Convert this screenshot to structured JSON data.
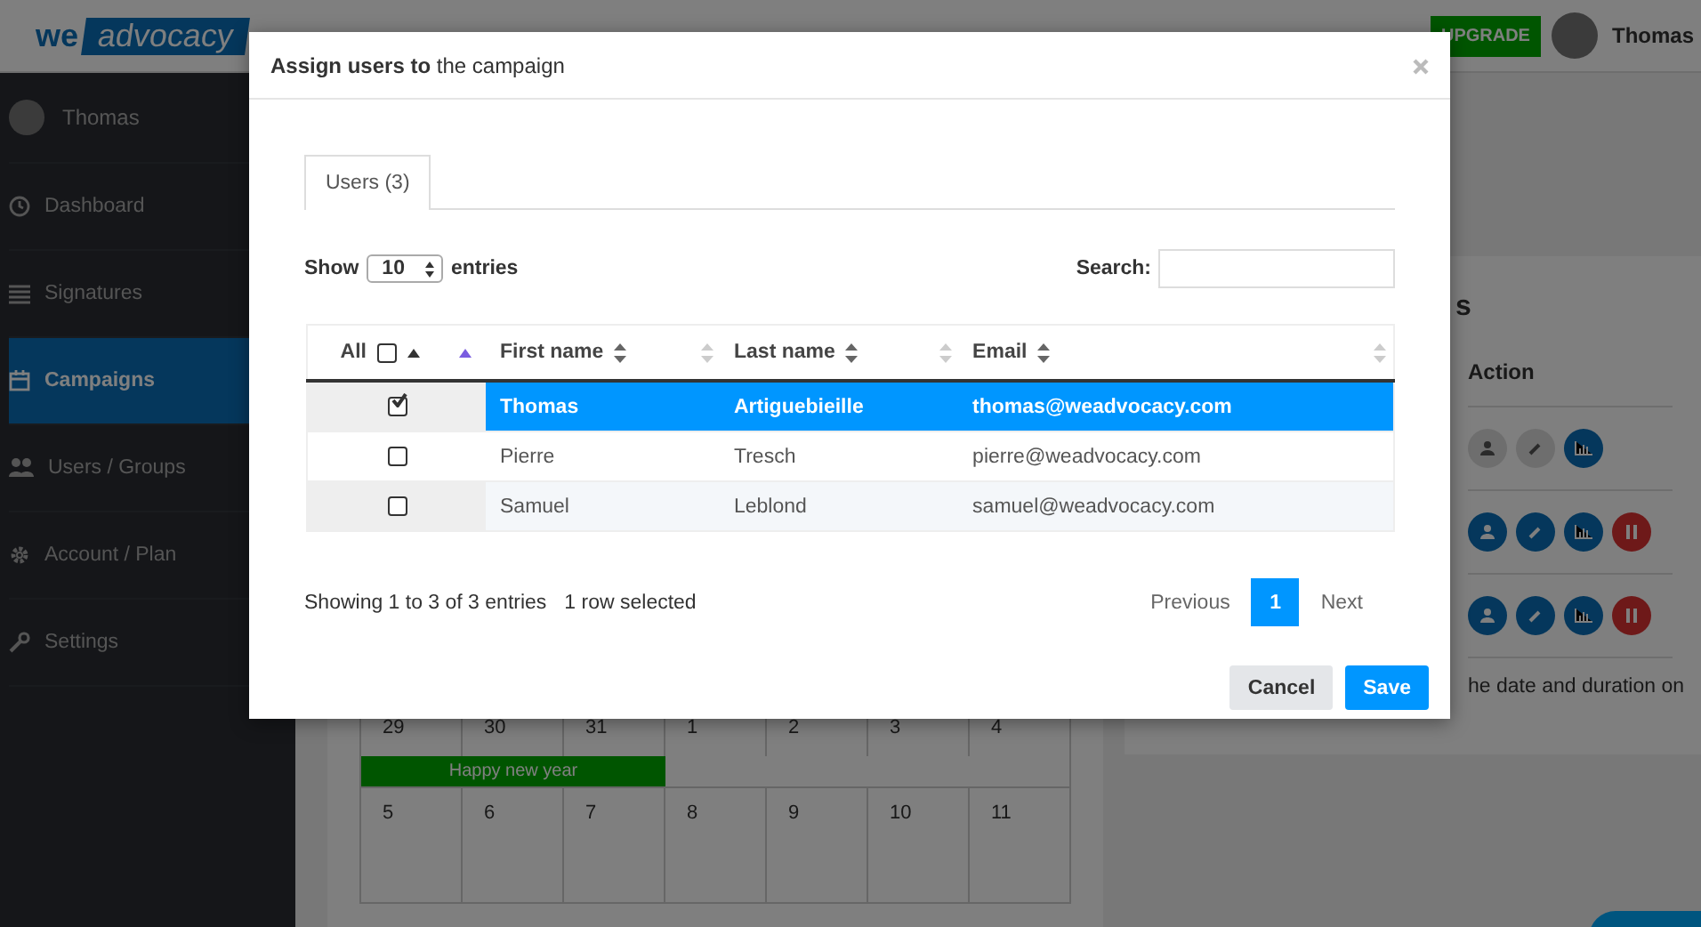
{
  "header": {
    "logo": {
      "left": "we",
      "right": "advocacy"
    },
    "upgrade": "UPGRADE",
    "user": "Thomas"
  },
  "sidebar": {
    "user": "Thomas",
    "items": [
      {
        "label": "Dashboard",
        "kind": "dashboard",
        "selected": false
      },
      {
        "label": "Signatures",
        "kind": "signatures",
        "selected": false
      },
      {
        "label": "Campaigns",
        "kind": "campaigns",
        "selected": true
      },
      {
        "label": "Users / Groups",
        "kind": "users",
        "selected": false
      },
      {
        "label": "Account / Plan",
        "kind": "account",
        "selected": false
      },
      {
        "label": "Settings",
        "kind": "settings",
        "selected": false
      }
    ]
  },
  "campaigns_panel": {
    "heading": "s",
    "action_header": "Action",
    "rows": [
      {
        "actions": [
          {
            "kind": "user",
            "enabled": false
          },
          {
            "kind": "edit",
            "enabled": false
          },
          {
            "kind": "stats",
            "enabled": true
          }
        ]
      },
      {
        "actions": [
          {
            "kind": "user",
            "enabled": true
          },
          {
            "kind": "edit",
            "enabled": true
          },
          {
            "kind": "stats",
            "enabled": true
          },
          {
            "kind": "pause",
            "enabled": true
          }
        ]
      },
      {
        "actions": [
          {
            "kind": "user",
            "enabled": true
          },
          {
            "kind": "edit",
            "enabled": true
          },
          {
            "kind": "stats",
            "enabled": true
          },
          {
            "kind": "pause",
            "enabled": true
          }
        ]
      }
    ],
    "note": "he date and duration on"
  },
  "calendar": {
    "weeks": [
      {
        "days": [
          "29",
          "30",
          "31",
          "1",
          "2",
          "3",
          "4"
        ],
        "events": [
          "Happy new year"
        ]
      },
      {
        "days": [
          "5",
          "6",
          "7",
          "8",
          "9",
          "10",
          "11"
        ]
      }
    ]
  },
  "modal": {
    "title_bold": "Assign users to",
    "title_rest": "the campaign",
    "tabs": [
      {
        "label": "Users (3)",
        "selected": true
      }
    ],
    "length": {
      "before": "Show",
      "value": "10",
      "after": "entries"
    },
    "search": {
      "label": "Search:"
    },
    "table": {
      "select_all": {
        "label": "All",
        "checked": false
      },
      "columns": [
        "First name",
        "Last name",
        "Email"
      ],
      "rows": [
        {
          "selected": true,
          "checked": true,
          "cells": [
            "Thomas",
            "Artiguebieille",
            "thomas@weadvocacy.com"
          ]
        },
        {
          "selected": false,
          "checked": false,
          "cells": [
            "Pierre",
            "Tresch",
            "pierre@weadvocacy.com"
          ]
        },
        {
          "selected": false,
          "checked": false,
          "cells": [
            "Samuel",
            "Leblond",
            "samuel@weadvocacy.com"
          ]
        }
      ]
    },
    "info": "Showing 1 to 3 of 3 entries",
    "selection_info": "1 row selected",
    "pagination": {
      "previous": "Previous",
      "pages": [
        {
          "label": "1",
          "selected": true
        }
      ],
      "next": "Next"
    },
    "buttons": [
      {
        "label": "Cancel",
        "kind": "secondary"
      },
      {
        "label": "Save",
        "kind": "primary"
      }
    ]
  }
}
